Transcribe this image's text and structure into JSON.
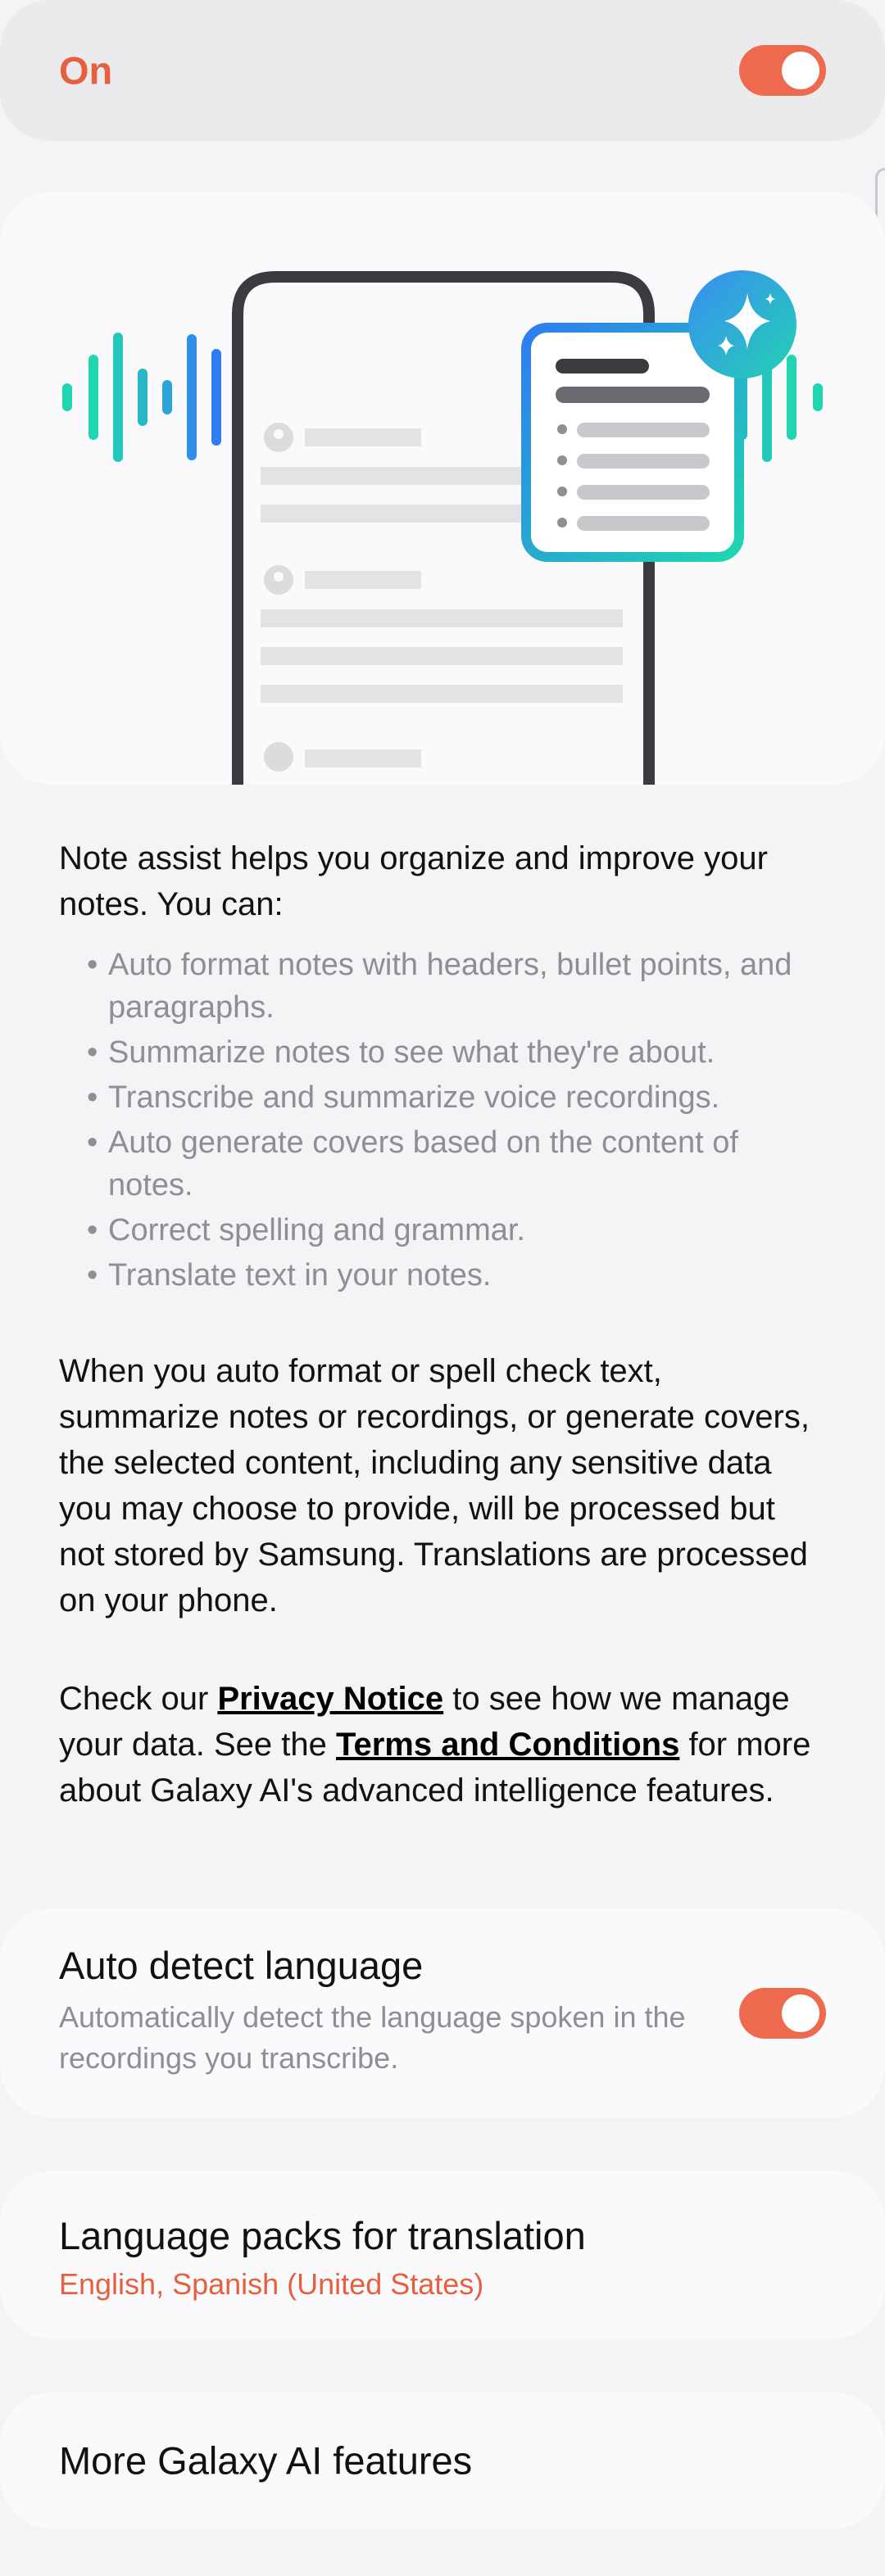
{
  "master_switch": {
    "label": "On",
    "state": "on"
  },
  "intro": "Note assist helps you organize and improve your notes. You can:",
  "features": [
    "Auto format notes with headers, bullet points, and paragraphs.",
    "Summarize notes to see what they're about.",
    "Transcribe and summarize voice recordings.",
    "Auto generate covers based on the content of notes.",
    "Correct spelling and grammar.",
    "Translate text in your notes."
  ],
  "processing_text": "When you auto format or spell check text, summarize notes or recordings, or generate covers, the selected content, including any sensitive data you may choose to provide, will be processed but not stored by Samsung. Translations are processed on your phone.",
  "privacy": {
    "prefix": "Check our",
    "privacy_link": "Privacy Notice",
    "middle": "to see how we manage your data. See the",
    "terms_link": "Terms and Conditions",
    "suffix": "for more about Galaxy AI's advanced intelligence features."
  },
  "auto_detect": {
    "title": "Auto detect language",
    "subtitle": "Automatically detect the language spoken in the recordings you transcribe.",
    "state": "on"
  },
  "language_packs": {
    "title": "Language packs for translation",
    "value": "English, Spanish (United States)"
  },
  "more_features": {
    "title": "More Galaxy AI features"
  },
  "colors": {
    "accent": "#ee6a4e",
    "accent_text": "#e5603f",
    "gradient_blue": "#2f7df0",
    "gradient_teal": "#1fd6b0"
  },
  "icons": {
    "illustration": "note-assist-illustration",
    "sparkle": "ai-sparkle-icon"
  }
}
